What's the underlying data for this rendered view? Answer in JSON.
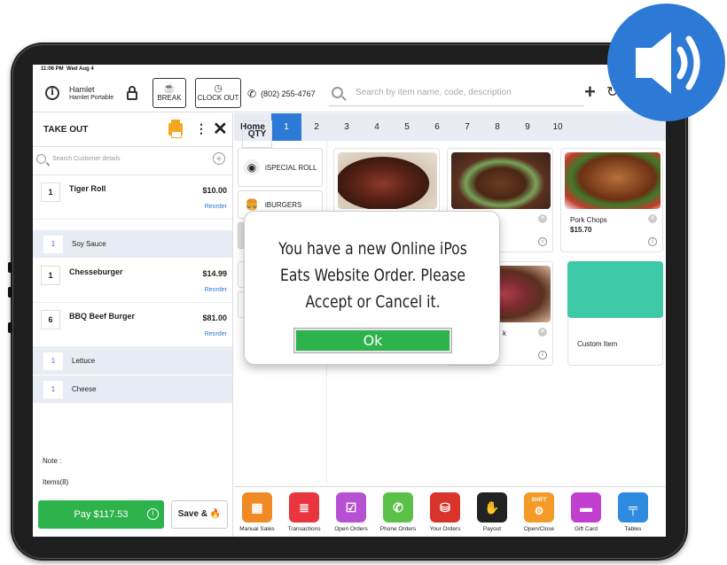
{
  "status": {
    "time": "11:06 PM",
    "date": "Wed Aug 4"
  },
  "header": {
    "store_name": "Hamlet",
    "store_sub": "Hamlet Portable",
    "break_label": "BREAK",
    "clockout_label": "CLOCK OUT",
    "phone": "(802) 255-4767",
    "search_placeholder": "Search by item name, code, description"
  },
  "order": {
    "type": "TAKE OUT",
    "customer_search_placeholder": "Search Customer details",
    "items": [
      {
        "qty": "1",
        "name": "Tiger Roll",
        "price": "$10.00",
        "reorder": "Reorder"
      },
      {
        "qty": "1",
        "name": "Chesseburger",
        "price": "$14.99",
        "reorder": "Reorder"
      },
      {
        "qty": "6",
        "name": "BBQ Beef Burger",
        "price": "$81.00",
        "reorder": "Reorder"
      }
    ],
    "modifiers": [
      {
        "qty": "1",
        "name": "Soy Sauce"
      },
      {
        "qty": "1",
        "name": "Lettuce"
      },
      {
        "qty": "1",
        "name": "Cheese"
      }
    ],
    "note_label": "Note :",
    "items_count": "Items(8)",
    "pay_label": "Pay $117.53",
    "save_label": "Save &"
  },
  "tabs": {
    "home": "Home",
    "qty": "QTY",
    "numbers": [
      "1",
      "2",
      "3",
      "4",
      "5",
      "6",
      "7",
      "8",
      "9",
      "10"
    ],
    "active": "1"
  },
  "categories": [
    {
      "name": "iSPECIAL ROLL"
    },
    {
      "name": "iBURGERS"
    }
  ],
  "products": [
    {
      "name": "Pork Chops",
      "price": "$15.70"
    },
    {
      "name": "k"
    },
    {
      "name": "Custom Item"
    }
  ],
  "footer": [
    {
      "label": "Manual Sales",
      "color": "#f08a24",
      "icon": "calculator-icon"
    },
    {
      "label": "Transactions",
      "color": "#e8353e",
      "icon": "receipt-icon"
    },
    {
      "label": "Open Orders",
      "color": "#b651d4",
      "icon": "clipboard-icon"
    },
    {
      "label": "Phone Orders",
      "color": "#5bc048",
      "icon": "phone-icon"
    },
    {
      "label": "Your Orders",
      "color": "#d9342b",
      "icon": "bag-icon"
    },
    {
      "label": "Payout",
      "color": "#222222",
      "icon": "cash-hand-icon"
    },
    {
      "label": "Open/Close",
      "color": "#f39a28",
      "icon": "shift-icon"
    },
    {
      "label": "Gift Card",
      "color": "#c23fcf",
      "icon": "gift-card-icon"
    },
    {
      "label": "Tables",
      "color": "#2f8be0",
      "icon": "tables-icon"
    }
  ],
  "footer_shift_badge": "SHIFT",
  "modal": {
    "message": "You have a new Online iPos Eats Website Order. Please Accept or Cancel it.",
    "ok_label": "Ok"
  },
  "colors": {
    "accent": "#2d7ad6",
    "success": "#2db24c",
    "speaker_bg": "#2d7ad6"
  }
}
